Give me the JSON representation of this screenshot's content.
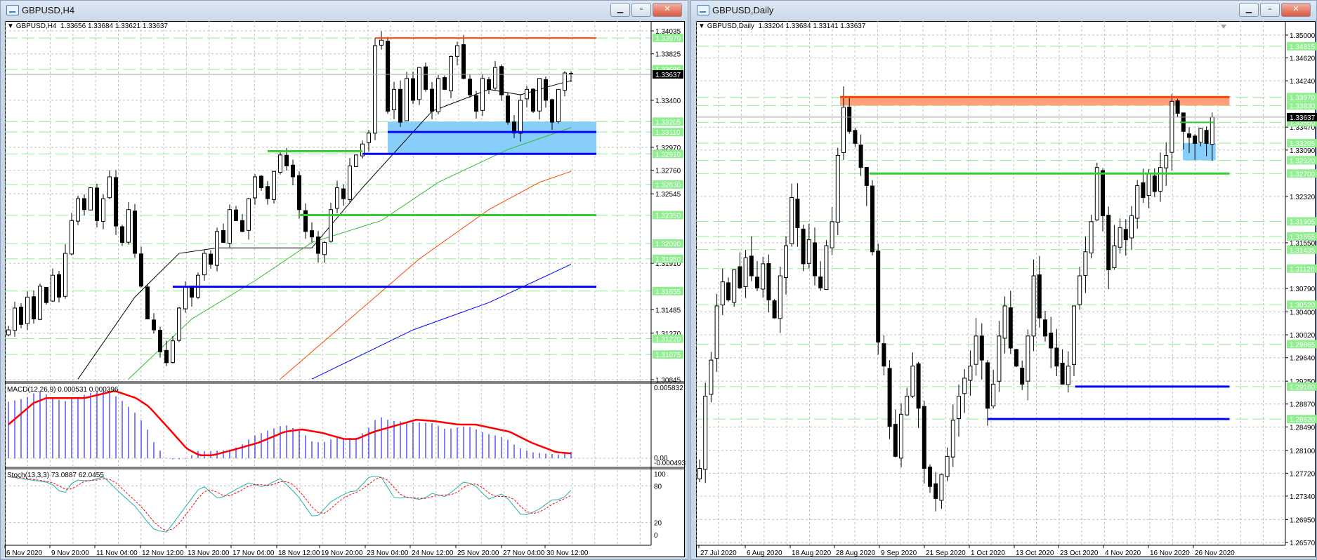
{
  "left_window": {
    "title": "GBPUSD,H4",
    "header": "GBPUSD,H4  1.33656 1.33684 1.33621 1.33637",
    "buttons": {
      "minimize": "▁",
      "restore": "▫",
      "close": "✕"
    },
    "macd_label": "MACD(12,26,9) 0.000531 0.000396",
    "stoch_label": "Stoch(13,3,3) 73.0887 62.0455",
    "current_price": "1.33637",
    "price_labels": [
      "1.34035",
      "1.33825",
      "1.33400",
      "1.32970",
      "1.32760",
      "1.32545",
      "1.31910",
      "1.31485",
      "1.31270",
      "1.30845"
    ],
    "level_labels": [
      "1.33970",
      "1.33685",
      "1.33205",
      "1.33110",
      "1.32910",
      "1.32630",
      "1.32350",
      "1.32090",
      "1.31950",
      "1.31655",
      "1.31220",
      "1.31075"
    ],
    "macd_scale": [
      "0.005832",
      "0.00",
      "-0.000493"
    ],
    "stoch_scale": [
      "100",
      "80",
      "20",
      "0"
    ],
    "dates": [
      "6 Nov 2020",
      "9 Nov 20:00",
      "11 Nov 04:00",
      "12 Nov 12:00",
      "13 Nov 20:00",
      "17 Nov 04:00",
      "18 Nov 12:00",
      "19 Nov 20:00",
      "23 Nov 04:00",
      "24 Nov 12:00",
      "25 Nov 20:00",
      "27 Nov 04:00",
      "30 Nov 12:00"
    ],
    "closes": [
      1.313,
      1.315,
      1.3135,
      1.316,
      1.314,
      1.317,
      1.3155,
      1.318,
      1.316,
      1.32,
      1.323,
      1.325,
      1.324,
      1.326,
      1.323,
      1.325,
      1.327,
      1.3225,
      1.321,
      1.324,
      1.32,
      1.317,
      1.314,
      1.313,
      1.311,
      1.31,
      1.312,
      1.315,
      1.317,
      1.316,
      1.318,
      1.32,
      1.319,
      1.322,
      1.321,
      1.324,
      1.323,
      1.322,
      1.325,
      1.327,
      1.326,
      1.325,
      1.3275,
      1.329,
      1.328,
      1.327,
      1.324,
      1.322,
      1.3215,
      1.32,
      1.321,
      1.324,
      1.326,
      1.325,
      1.328,
      1.329,
      1.33,
      1.331,
      1.339,
      1.3395,
      1.333,
      1.335,
      1.332,
      1.336,
      1.334,
      1.337,
      1.335,
      1.333,
      1.336,
      1.335,
      1.338,
      1.339,
      1.336,
      1.3345,
      1.333,
      1.336,
      1.335,
      1.337,
      1.3345,
      1.332,
      1.331,
      1.334,
      1.335,
      1.333,
      1.336,
      1.334,
      1.332,
      1.335,
      1.3365,
      1.33637
    ],
    "moving_averages": [
      {
        "color": "#000000",
        "points": [
          [
            11,
            1.3085
          ],
          [
            20,
            1.316
          ],
          [
            27,
            1.32
          ],
          [
            33,
            1.3205
          ],
          [
            48,
            1.3205
          ],
          [
            56,
            1.326
          ],
          [
            67,
            1.333
          ],
          [
            76,
            1.335
          ],
          [
            81,
            1.3345
          ],
          [
            87,
            1.3355
          ],
          [
            89,
            1.3358
          ]
        ]
      },
      {
        "color": "#33bb33",
        "points": [
          [
            19,
            1.3085
          ],
          [
            29,
            1.314
          ],
          [
            39,
            1.3175
          ],
          [
            48,
            1.321
          ],
          [
            59,
            1.323
          ],
          [
            68,
            1.3265
          ],
          [
            79,
            1.3295
          ],
          [
            89,
            1.3315
          ]
        ]
      },
      {
        "color": "#ff4500",
        "points": [
          [
            43,
            1.3085
          ],
          [
            55,
            1.3145
          ],
          [
            65,
            1.3195
          ],
          [
            76,
            1.324
          ],
          [
            84,
            1.3265
          ],
          [
            89,
            1.3275
          ]
        ]
      },
      {
        "color": "#0000ff",
        "points": [
          [
            48,
            1.3085
          ],
          [
            64,
            1.313
          ],
          [
            76,
            1.3155
          ],
          [
            89,
            1.319
          ]
        ]
      }
    ],
    "objects": [
      {
        "type": "rect",
        "from": 60,
        "to": 93,
        "p1": 1.33205,
        "p2": 1.3291,
        "color": "#87cefa"
      },
      {
        "type": "line",
        "from": 58,
        "to": 93,
        "price": 1.3397,
        "color": "#ff4500",
        "width": 2
      },
      {
        "type": "line",
        "from": 60,
        "to": 93,
        "price": 1.3311,
        "color": "#0000ff",
        "width": 3
      },
      {
        "type": "line",
        "from": 56,
        "to": 93,
        "price": 1.3291,
        "color": "#0000ff",
        "width": 3
      },
      {
        "type": "line",
        "from": 41,
        "to": 56,
        "price": 1.32935,
        "color": "#32cd32",
        "width": 3
      },
      {
        "type": "line",
        "from": 46,
        "to": 93,
        "price": 1.3235,
        "color": "#32cd32",
        "width": 3
      },
      {
        "type": "line",
        "from": 26,
        "to": 93,
        "price": 1.31695,
        "color": "#0000ff",
        "width": 3
      }
    ],
    "macd_hist": [
      [
        0,
        4.7
      ],
      [
        2.7,
        5.0
      ],
      [
        4.7,
        5.6
      ],
      [
        8.7,
        4.7
      ],
      [
        13.4,
        5.5
      ],
      [
        15.5,
        5.6
      ],
      [
        17.5,
        5.0
      ],
      [
        20.2,
        3.7
      ],
      [
        21.8,
        2.6
      ],
      [
        22.8,
        1.5
      ],
      [
        23.9,
        0.7
      ],
      [
        24.9,
        0.05
      ],
      [
        25.5,
        -0.1
      ],
      [
        28.2,
        -0.05
      ],
      [
        29.9,
        0.6
      ],
      [
        32.3,
        0.6
      ],
      [
        34.9,
        0.7
      ],
      [
        36.6,
        1.0
      ],
      [
        38.6,
        1.8
      ],
      [
        41,
        2.3
      ],
      [
        43.7,
        2.8
      ],
      [
        46.4,
        2.2
      ],
      [
        48,
        1.4
      ],
      [
        49.7,
        1.3
      ],
      [
        51.7,
        1.7
      ],
      [
        55.1,
        1.7
      ],
      [
        56.8,
        2.4
      ],
      [
        58.5,
        3.5
      ],
      [
        60.5,
        3.1
      ],
      [
        64.5,
        3.0
      ],
      [
        67.2,
        2.9
      ],
      [
        69.2,
        2.4
      ],
      [
        72.6,
        2.7
      ],
      [
        75.3,
        2.1
      ],
      [
        78.6,
        1.7
      ],
      [
        80.6,
        0.9
      ],
      [
        82.7,
        0.5
      ],
      [
        84.7,
        0.4
      ],
      [
        87.4,
        0.3
      ],
      [
        89,
        0.53
      ]
    ],
    "macd_signal": [
      [
        0,
        2.8
      ],
      [
        4,
        4.6
      ],
      [
        6,
        5.0
      ],
      [
        12.1,
        5.0
      ],
      [
        16.8,
        5.6
      ],
      [
        20.2,
        5.0
      ],
      [
        22.2,
        4.3
      ],
      [
        25.5,
        2.4
      ],
      [
        28.2,
        0.8
      ],
      [
        30.2,
        0.25
      ],
      [
        32.3,
        0.25
      ],
      [
        35.6,
        0.7
      ],
      [
        39.6,
        1.3
      ],
      [
        43.7,
        2.2
      ],
      [
        46.4,
        2.4
      ],
      [
        49.7,
        2.1
      ],
      [
        53.1,
        1.6
      ],
      [
        55.1,
        1.6
      ],
      [
        57.8,
        2.2
      ],
      [
        64.5,
        3.2
      ],
      [
        67.2,
        3.1
      ],
      [
        71.2,
        2.8
      ],
      [
        73.9,
        2.8
      ],
      [
        79.3,
        2.2
      ],
      [
        82.7,
        1.3
      ],
      [
        86.7,
        0.5
      ],
      [
        89,
        0.4
      ]
    ],
    "stoch_main": [
      [
        0,
        95
      ],
      [
        6.7,
        85
      ],
      [
        8.7,
        65
      ],
      [
        10.4,
        90
      ],
      [
        12.8,
        88
      ],
      [
        15.1,
        95
      ],
      [
        17.5,
        70
      ],
      [
        20.2,
        45
      ],
      [
        22.8,
        10
      ],
      [
        24.9,
        3
      ],
      [
        27.6,
        40
      ],
      [
        30.6,
        82
      ],
      [
        33.3,
        58
      ],
      [
        35.6,
        72
      ],
      [
        38,
        85
      ],
      [
        40.3,
        78
      ],
      [
        43,
        92
      ],
      [
        45.7,
        65
      ],
      [
        48.4,
        25
      ],
      [
        51.1,
        55
      ],
      [
        53.8,
        70
      ],
      [
        55.1,
        72
      ],
      [
        57.1,
        95
      ],
      [
        58.8,
        97
      ],
      [
        61.2,
        58
      ],
      [
        62.8,
        62
      ],
      [
        65.5,
        57
      ],
      [
        66.9,
        68
      ],
      [
        69.2,
        62
      ],
      [
        72.2,
        88
      ],
      [
        73.9,
        80
      ],
      [
        75.9,
        58
      ],
      [
        78.3,
        68
      ],
      [
        81.3,
        30
      ],
      [
        83.7,
        40
      ],
      [
        86.4,
        60
      ],
      [
        87.4,
        56
      ],
      [
        89,
        73.09
      ]
    ]
  },
  "right_window": {
    "title": "GBPUSD,Daily",
    "header": "GBPUSD,Daily  1.33204 1.33684 1.33141 1.33637",
    "buttons": {
      "minimize": "▁",
      "restore": "▫",
      "close": "✕"
    },
    "current_price": "1.33637",
    "price_labels": [
      "1.35000",
      "1.34620",
      "1.34240",
      "1.33470",
      "1.33090",
      "1.32320",
      "1.31550",
      "1.30790",
      "1.30400",
      "1.30020",
      "1.29640",
      "1.29250",
      "1.28870",
      "1.28490",
      "1.28100",
      "1.27720",
      "1.27340",
      "1.26950",
      "1.26570"
    ],
    "level_labels": [
      "1.34815",
      "1.33970",
      "1.33830",
      "1.33550",
      "1.33205",
      "1.32920",
      "1.32700",
      "1.31905",
      "1.31655",
      "1.31435",
      "1.31120",
      "1.30520",
      "1.29865",
      "1.29160",
      "1.28620"
    ],
    "dates": [
      "27 Jul 2020",
      "6 Aug 2020",
      "18 Aug 2020",
      "28 Aug 2020",
      "9 Sep 2020",
      "21 Sep 2020",
      "1 Oct 2020",
      "13 Oct 2020",
      "23 Oct 2020",
      "4 Nov 2020",
      "16 Nov 2020",
      "26 Nov 2020"
    ],
    "closes": [
      1.278,
      1.29,
      1.296,
      1.305,
      1.309,
      1.306,
      1.311,
      1.308,
      1.313,
      1.31,
      1.308,
      1.312,
      1.306,
      1.303,
      1.31,
      1.315,
      1.323,
      1.318,
      1.312,
      1.316,
      1.31,
      1.308,
      1.315,
      1.319,
      1.33,
      1.338,
      1.334,
      1.332,
      1.328,
      1.325,
      1.314,
      1.299,
      1.295,
      1.285,
      1.28,
      1.287,
      1.29,
      1.295,
      1.288,
      1.278,
      1.275,
      1.273,
      1.277,
      1.28,
      1.286,
      1.29,
      1.293,
      1.295,
      1.3,
      1.296,
      1.288,
      1.292,
      1.3,
      1.305,
      1.298,
      1.295,
      1.292,
      1.3,
      1.31,
      1.303,
      1.3,
      1.298,
      1.295,
      1.292,
      1.295,
      1.305,
      1.31,
      1.314,
      1.319,
      1.328,
      1.32,
      1.311,
      1.315,
      1.318,
      1.316,
      1.32,
      1.325,
      1.323,
      1.327,
      1.324,
      1.328,
      1.33,
      1.339,
      1.337,
      1.334,
      1.333,
      1.332,
      1.3345,
      1.332,
      1.33637
    ],
    "objects": [
      {
        "type": "rect",
        "from": 24.4,
        "to": 92,
        "p1": 1.3397,
        "p2": 1.3383,
        "color": "#ffa07a"
      },
      {
        "type": "line",
        "from": 24.4,
        "to": 92,
        "price": 1.3397,
        "color": "#ff4500",
        "width": 3
      },
      {
        "type": "rect",
        "from": 83.9,
        "to": 89.6,
        "p1": 1.33205,
        "p2": 1.3292,
        "color": "#87cefa"
      },
      {
        "type": "line",
        "from": 83.4,
        "to": 89.5,
        "price": 1.3355,
        "color": "#32cd32",
        "width": 2
      },
      {
        "type": "line",
        "from": 29.5,
        "to": 92,
        "price": 1.327,
        "color": "#32cd32",
        "width": 3
      },
      {
        "type": "line",
        "from": 65.2,
        "to": 92,
        "price": 1.2916,
        "color": "#0000ff",
        "width": 3
      },
      {
        "type": "line",
        "from": 50,
        "to": 92,
        "price": 1.2862,
        "color": "#0000ff",
        "width": 3
      }
    ]
  },
  "colors": {
    "level_badge": "#90ee90",
    "bull": "#ffffff",
    "bear": "#000000",
    "macd_hist": "#0000ff",
    "macd_signal": "#ff0000",
    "stoch_main": "#20b2aa",
    "stoch_signal": "#ff0000"
  }
}
